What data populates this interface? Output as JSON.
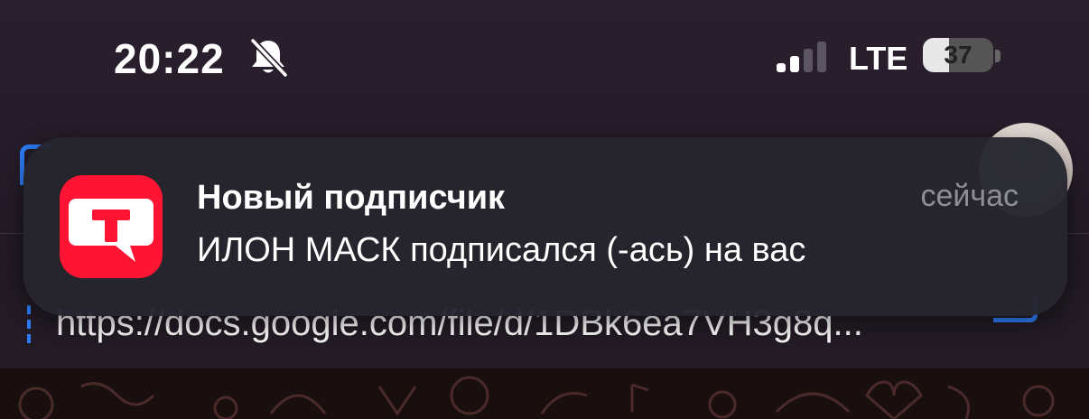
{
  "status_bar": {
    "time": "20:22",
    "mute_icon": "bell-slash-icon",
    "signal_icon": "cellular-signal-icon",
    "signal_strength_bars": 2,
    "signal_total_bars": 4,
    "network": "LTE",
    "battery_level": "37",
    "battery_fraction": 0.37
  },
  "chat_header": {
    "back_icon": "back-chevron-icon",
    "title_fragment": "...",
    "avatar_icon": "avatar-photo"
  },
  "pinned": {
    "link": "https://docs.google.com/file/d/1DBk6ea7VH3g8q..."
  },
  "notification": {
    "app_icon": "tamtam-app-icon",
    "app_icon_letter": "T",
    "title": "Новый подписчик",
    "time": "сейчас",
    "body": "ИЛОН МАСК подписался (-ась) на вас"
  },
  "colors": {
    "accent": "#2e7cf6",
    "app_icon_bg": "#ff1433",
    "notification_bg": "#26262e",
    "secondary_text": "#8e8e96"
  }
}
